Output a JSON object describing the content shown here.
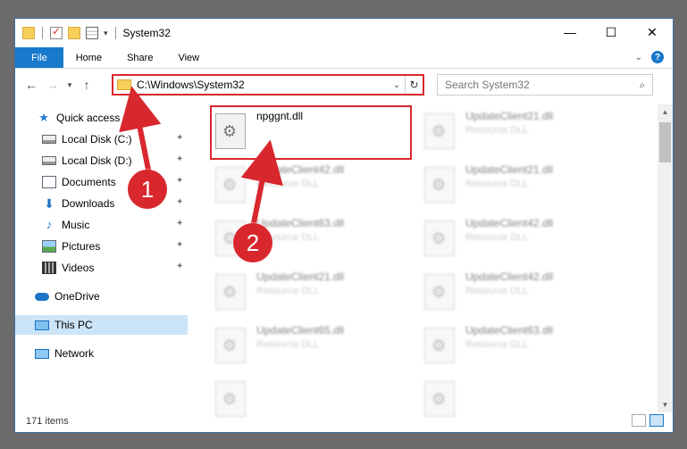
{
  "window": {
    "title": "System32",
    "controls": {
      "minimize": "—",
      "maximize": "☐",
      "close": "✕"
    }
  },
  "ribbon": {
    "tabs": [
      "File",
      "Home",
      "Share",
      "View"
    ],
    "help": "?"
  },
  "address": {
    "path": "C:\\Windows\\System32",
    "search_placeholder": "Search System32"
  },
  "sidebar": {
    "quick_access": "Quick access",
    "items": [
      "Local Disk (C:)",
      "Local Disk (D:)",
      "Documents",
      "Downloads",
      "Music",
      "Pictures",
      "Videos"
    ],
    "onedrive": "OneDrive",
    "this_pc": "This PC",
    "network": "Network"
  },
  "files": {
    "selected": {
      "name": "npggnt.dll"
    },
    "background": [
      {
        "name": "UpdateClient21.dll",
        "type": "Resource DLL"
      },
      {
        "name": "UpdateClient42.dll",
        "type": "Resource DLL"
      },
      {
        "name": "UpdateClient21.dll",
        "type": "Resource DLL"
      },
      {
        "name": "UpdateClient63.dll",
        "type": "Resource DLL"
      },
      {
        "name": "UpdateClient42.dll",
        "type": "Resource DLL"
      },
      {
        "name": "UpdateClient21.dll",
        "type": "Resource DLL"
      },
      {
        "name": "UpdateClient42.dll",
        "type": "Resource DLL"
      },
      {
        "name": "UpdateClient65.dll",
        "type": "Resource DLL"
      },
      {
        "name": "UpdateClient63.dll",
        "type": "Resource DLL"
      }
    ]
  },
  "status": {
    "item_count": "171 items"
  },
  "annotations": {
    "step1": "1",
    "step2": "2",
    "color": "#d9272e"
  }
}
